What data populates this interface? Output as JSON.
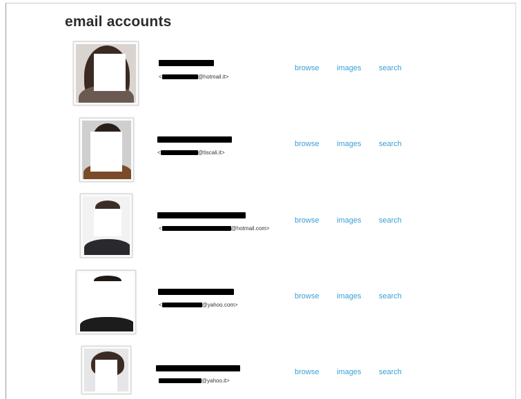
{
  "page": {
    "heading": "email accounts"
  },
  "accounts": [
    {
      "email_prefix": "<",
      "email_domain": "@hotmail.it>",
      "actions": {
        "browse": "browse",
        "images": "images",
        "search": "search"
      }
    },
    {
      "email_prefix": "<",
      "email_domain": "@tiscali.it>",
      "actions": {
        "browse": "browse",
        "images": "images",
        "search": "search"
      }
    },
    {
      "email_prefix": "<",
      "email_domain": "@hotmail.com>",
      "actions": {
        "browse": "browse",
        "images": "images",
        "search": "search"
      }
    },
    {
      "email_prefix": "<",
      "email_domain": "@yahoo.com>",
      "actions": {
        "browse": "browse",
        "images": "images",
        "search": "search"
      }
    },
    {
      "email_prefix": "",
      "email_domain": "@yahoo.it>",
      "actions": {
        "browse": "browse",
        "images": "images",
        "search": "search"
      }
    }
  ],
  "colors": {
    "link": "#3a9fd4",
    "heading": "#2c2c2c",
    "redaction": "#000000"
  }
}
